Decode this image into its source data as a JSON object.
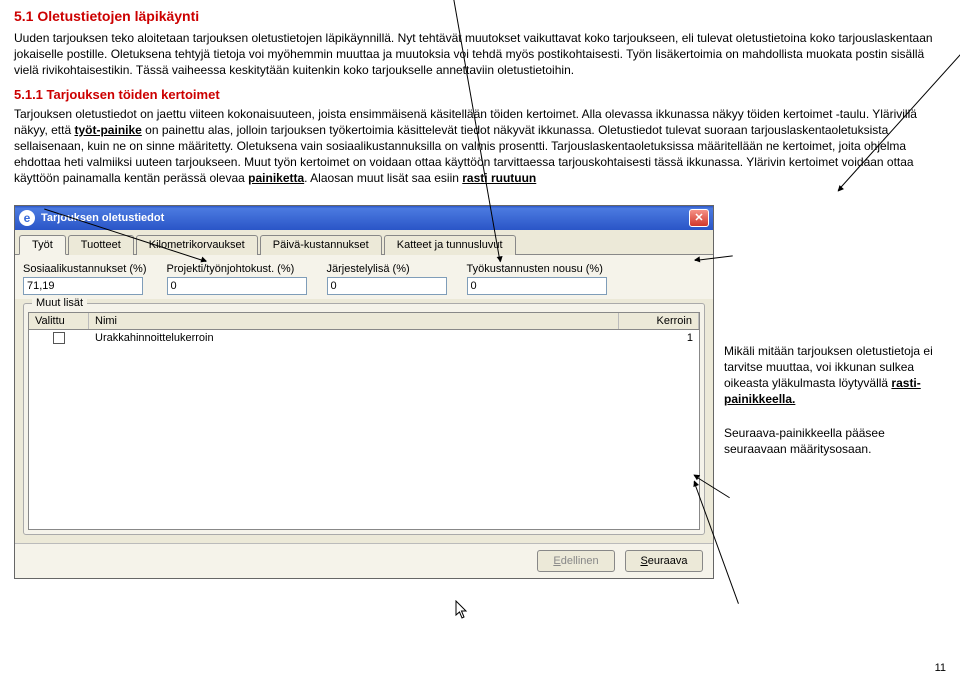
{
  "headings": {
    "h1": "5.1 Oletustietojen läpikäynti",
    "h2": "5.1.1 Tarjouksen töiden kertoimet"
  },
  "paragraphs": {
    "p1": "Uuden tarjouksen teko aloitetaan tarjouksen oletustietojen läpikäynnillä. Nyt tehtävät muutokset vaikuttavat koko tarjoukseen, eli tulevat oletustietoina koko tarjouslaskentaan jokaiselle postille. Oletuksena tehtyjä tietoja voi myöhemmin muuttaa ja muutoksia voi tehdä myös postikohtaisesti. Työn lisäkertoimia on mahdollista muokata postin sisällä vielä rivikohtaisestikin. Tässä vaiheessa keskitytään kuitenkin koko tarjoukselle annettaviin oletustietoihin.",
    "p2a": "Tarjouksen oletustiedot on jaettu viiteen kokonaisuuteen, joista ensimmäisenä käsitellään töiden kertoimet. Alla olevassa ikkunassa näkyy töiden kertoimet -taulu. Ylärivillä näkyy, että ",
    "p2b": " on painettu alas, jolloin tarjouksen työkertoimia käsittelevät tiedot näkyvät ikkunassa. Oletustiedot tulevat suoraan tarjouslaskentaoletuksista sellaisenaan, kuin ne on sinne määritetty. Oletuksena vain sosiaalikustannuksilla on valmis prosentti. Tarjouslaskentaoletuksissa määritellään ne kertoimet, joita ohjelma ehdottaa heti valmiiksi uuteen tarjoukseen. Muut työn kertoimet on voidaan ottaa käyttöön tarvittaessa tarjouskohtaisesti tässä ikkunassa. Ylärivin kertoimet voidaan ottaa käyttöön painamalla kentän perässä olevaa ",
    "p2c": ". Alaosan muut lisät saa esiin ",
    "tyot_painike": "työt-painike",
    "painiketta": "painiketta",
    "rasti_ruutuun": "rasti ruutuun"
  },
  "side": {
    "s1a": "Mikäli mitään tarjouksen oletustietoja ei tarvitse muuttaa, voi ikkunan sulkea oikeasta yläkulmasta löytyvällä ",
    "s1b": "rasti-painikkeella.",
    "s2": "Seuraava-painikkeella pääsee seuraavaan määritysosaan."
  },
  "window": {
    "title": "Tarjouksen oletustiedot",
    "tabs": [
      "Työt",
      "Tuotteet",
      "Kilometrikorvaukset",
      "Päivä-kustannukset",
      "Katteet ja tunnusluvut"
    ],
    "fields": {
      "sosiaali_label": "Sosiaalikustannukset (%)",
      "sosiaali_value": "71,19",
      "projekti_label": "Projekti/työnjohtokust. (%)",
      "projekti_value": "0",
      "jarjestely_label": "Järjestelylisä (%)",
      "jarjestely_value": "0",
      "tyokust_label": "Työkustannusten nousu (%)",
      "tyokust_value": "0"
    },
    "groupbox": "Muut lisät",
    "listcols": {
      "valittu": "Valittu",
      "nimi": "Nimi",
      "kerroin": "Kerroin"
    },
    "row1": {
      "nimi": "Urakkahinnoittelukerroin",
      "kerroin": "1"
    },
    "buttons": {
      "edellinen_mn": "E",
      "edellinen": "dellinen",
      "seuraava_mn": "S",
      "seuraava": "euraava"
    }
  },
  "pagenum": "11"
}
